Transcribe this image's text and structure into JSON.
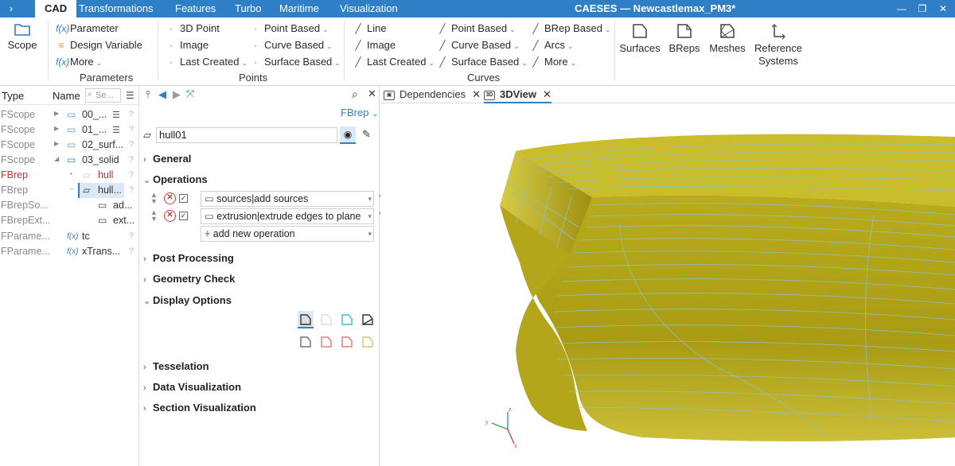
{
  "titlebar": {
    "menu_icon": "›",
    "tabs": [
      "CAD",
      "Transformations",
      "Features",
      "Turbo",
      "Maritime",
      "Visualization"
    ],
    "title": "CAESES  —  Newcastlemax_PM3*",
    "min": "—",
    "restore": "❐",
    "close": "✕"
  },
  "ribbon": {
    "scope": "Scope",
    "parameters": {
      "items": [
        "Parameter",
        "Design Variable",
        "More"
      ],
      "label": "Parameters"
    },
    "points": {
      "col1": [
        "3D Point",
        "Image",
        "Last Created"
      ],
      "col2": [
        "Point Based",
        "Curve Based",
        "Surface Based"
      ],
      "label": "Points"
    },
    "curves": {
      "col1": [
        "Line",
        "Image",
        "Last Created"
      ],
      "col2": [
        "Point Based",
        "Curve Based",
        "Surface Based"
      ],
      "col3": [
        "BRep Based",
        "Arcs",
        "More"
      ],
      "label": "Curves"
    },
    "big": [
      "Surfaces",
      "BReps",
      "Meshes",
      "Reference Systems"
    ]
  },
  "tree": {
    "col_type": "Type",
    "col_name": "Name",
    "search_placeholder": "Se...",
    "rows": [
      {
        "type": "FScope",
        "name": "00_..."
      },
      {
        "type": "FScope",
        "name": "01_..."
      },
      {
        "type": "FScope",
        "name": "02_surf..."
      },
      {
        "type": "FScope",
        "name": "03_solid"
      },
      {
        "type": "FBrep",
        "name": "hull"
      },
      {
        "type": "FBrep",
        "name": "hull..."
      },
      {
        "type": "FBrepSo...",
        "name": "ad..."
      },
      {
        "type": "FBrepExt...",
        "name": "ext..."
      },
      {
        "type": "FParame...",
        "name": "tc"
      },
      {
        "type": "FParame...",
        "name": "xTrans..."
      }
    ],
    "q": "?"
  },
  "props": {
    "type_selector": "FBrep",
    "object_name": "hull01",
    "sections": {
      "general": "General",
      "operations": "Operations",
      "post": "Post Processing",
      "geom": "Geometry Check",
      "display": "Display Options",
      "tess": "Tesselation",
      "datavis": "Data Visualization",
      "secvis": "Section Visualization"
    },
    "ops": [
      "sources|add sources",
      "extrusion|extrude edges to plane"
    ],
    "add_op": "add new operation"
  },
  "view": {
    "tabs": [
      "Dependencies",
      "3DView"
    ],
    "axes": {
      "x": "x",
      "y": "y",
      "z": "z"
    },
    "colors": {
      "hull": "#c9bd2c",
      "hull_dark": "#8f8410",
      "lines": "#8fbfbf"
    }
  }
}
